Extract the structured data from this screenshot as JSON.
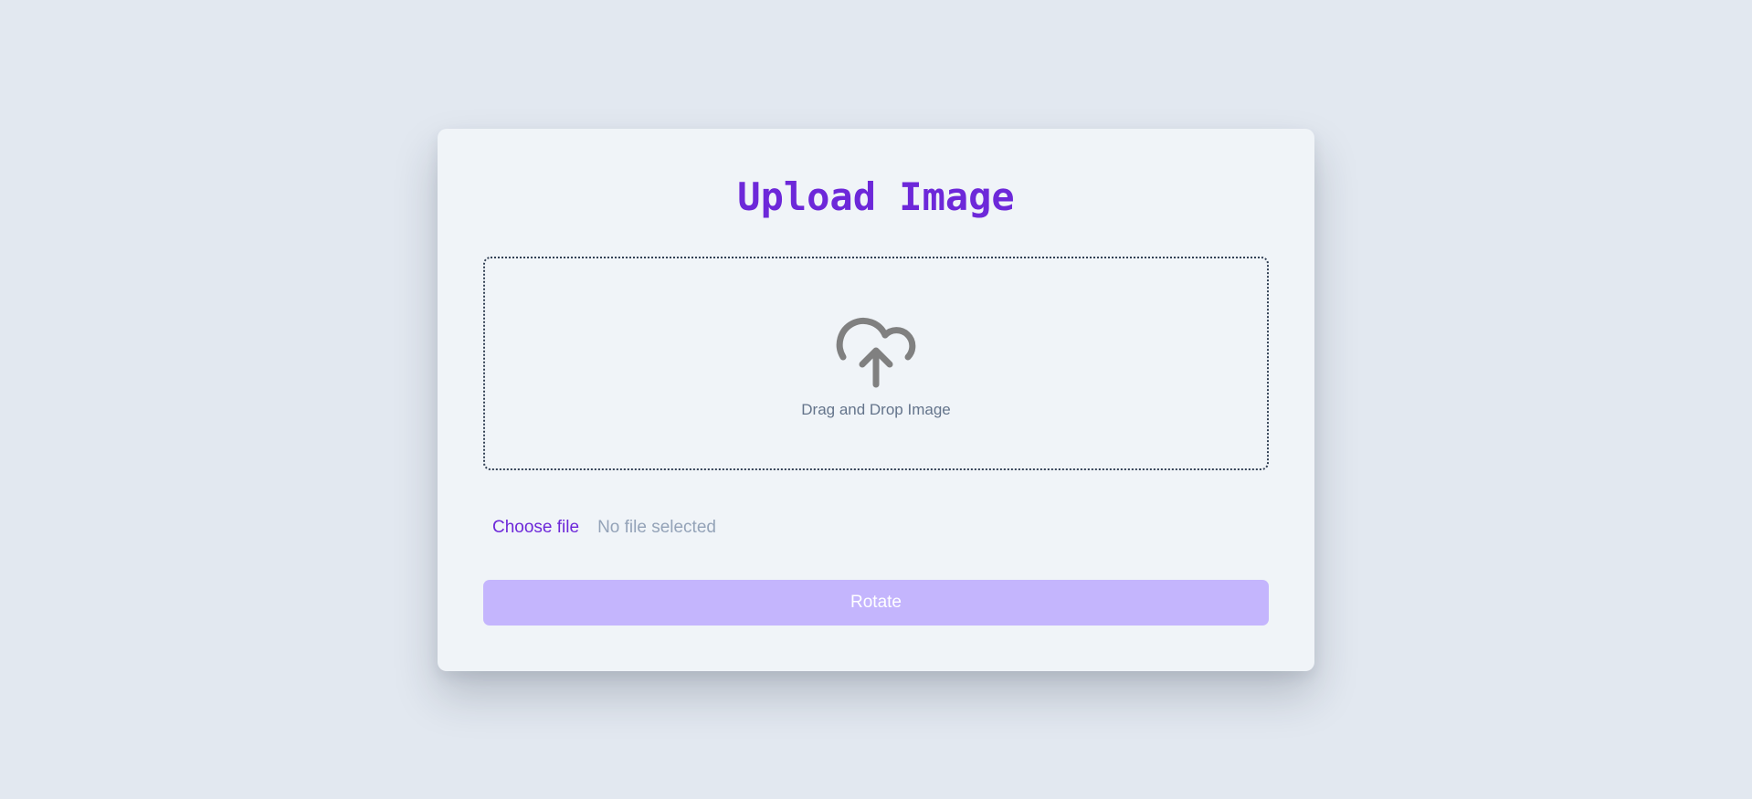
{
  "card": {
    "title": "Upload Image"
  },
  "dropzone": {
    "icon": "cloud-upload-icon",
    "hint": "Drag and Drop Image"
  },
  "file_input": {
    "button_label": "Choose file",
    "status": "No file selected"
  },
  "actions": {
    "rotate_label": "Rotate",
    "rotate_disabled": true
  },
  "colors": {
    "background": "#e2e8f0",
    "card": "#f0f4f8",
    "accent": "#6d28d9",
    "button_disabled": "#c4b5fd",
    "icon": "#808080",
    "muted_text": "#64748b"
  }
}
